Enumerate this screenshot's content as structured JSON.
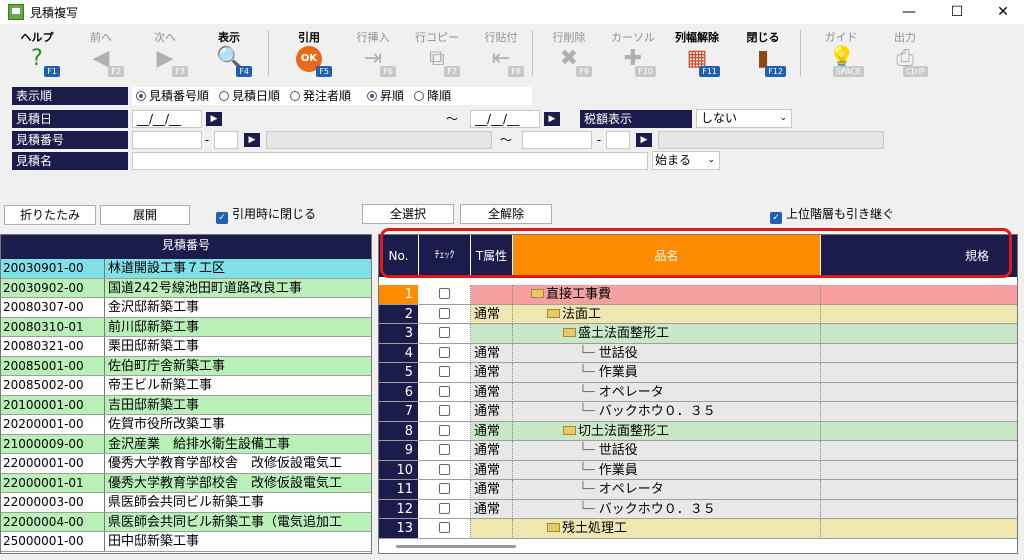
{
  "window": {
    "title": "見積複写"
  },
  "toolbar": [
    {
      "label": "ヘルプ",
      "key": "F1",
      "enabled": true,
      "icon": "help-icon",
      "glyph": "?",
      "color": "#2e8b2e"
    },
    {
      "label": "前へ",
      "key": "F2",
      "enabled": false,
      "icon": "arrow-left-icon",
      "glyph": "◀",
      "color": "#b0b0b0"
    },
    {
      "label": "次へ",
      "key": "F3",
      "enabled": false,
      "icon": "arrow-right-icon",
      "glyph": "▶",
      "color": "#b0b0b0"
    },
    {
      "label": "表示",
      "key": "F4",
      "enabled": true,
      "icon": "magnifier-icon",
      "glyph": "🔍",
      "color": "#3a6ea5"
    },
    {
      "label": "引用",
      "key": "F5",
      "enabled": true,
      "icon": "ok-icon",
      "glyph": "OK",
      "color": "#e86a1a"
    },
    {
      "label": "行挿入",
      "key": "F6",
      "enabled": false,
      "icon": "insert-row-icon",
      "glyph": "⇥",
      "color": "#b0b0b0"
    },
    {
      "label": "行コピー",
      "key": "F7",
      "enabled": false,
      "icon": "copy-row-icon",
      "glyph": "⧉",
      "color": "#b0b0b0"
    },
    {
      "label": "行貼付",
      "key": "F8",
      "enabled": false,
      "icon": "paste-row-icon",
      "glyph": "⇤",
      "color": "#b0b0b0"
    },
    {
      "label": "行削除",
      "key": "F9",
      "enabled": false,
      "icon": "delete-row-icon",
      "glyph": "✖",
      "color": "#b0b0b0"
    },
    {
      "label": "カーソル",
      "key": "F10",
      "enabled": false,
      "icon": "cursor-icon",
      "glyph": "✚",
      "color": "#b0b0b0"
    },
    {
      "label": "列幅解除",
      "key": "F11",
      "enabled": true,
      "icon": "column-width-icon",
      "glyph": "▦",
      "color": "#d04a2a"
    },
    {
      "label": "閉じる",
      "key": "F12",
      "enabled": true,
      "icon": "door-icon",
      "glyph": "▮",
      "color": "#8b4a1a"
    },
    {
      "label": "ガイド",
      "key": "SPACE",
      "enabled": false,
      "icon": "bulb-icon",
      "glyph": "💡",
      "color": "#b0b0b0"
    },
    {
      "label": "出力",
      "key": "CtrlP",
      "enabled": false,
      "icon": "output-icon",
      "glyph": "⎙",
      "color": "#b0b0b0"
    }
  ],
  "filters": {
    "order_label": "表示順",
    "order_options": [
      "見積番号順",
      "見積日順",
      "発注者順"
    ],
    "order_selected": 0,
    "direction_options": [
      "昇順",
      "降順"
    ],
    "direction_selected": 0,
    "date_label": "見積日",
    "date_from": "__/__/__",
    "date_to": "__/__/__",
    "tilde": "～",
    "tax_label": "税額表示",
    "tax_value": "しない",
    "number_label": "見積番号",
    "name_label": "見積名",
    "match_value": "始まる"
  },
  "actions": {
    "collapse": "折りたたみ",
    "expand": "展開",
    "close_on_quote": "引用時に閉じる",
    "select_all": "全選択",
    "deselect_all": "全解除",
    "inherit_parent": "上位階層も引き継ぐ"
  },
  "list": {
    "header": "見積番号",
    "rows": [
      {
        "no": "20030901-00",
        "name": "林道開設工事７工区",
        "bg": "#7fe0e8"
      },
      {
        "no": "20030902-00",
        "name": "国道242号線池田町道路改良工事",
        "bg": "#b8f0b8"
      },
      {
        "no": "20080307-00",
        "name": "金沢邸新築工事",
        "bg": "#ffffff"
      },
      {
        "no": "20080310-01",
        "name": "前川邸新築工事",
        "bg": "#b8f0b8"
      },
      {
        "no": "20080321-00",
        "name": "栗田邸新築工事",
        "bg": "#ffffff"
      },
      {
        "no": "20085001-00",
        "name": "佐伯町庁舎新築工事",
        "bg": "#b8f0b8"
      },
      {
        "no": "20085002-00",
        "name": "帝王ビル新築工事",
        "bg": "#ffffff"
      },
      {
        "no": "20100001-00",
        "name": "吉田邸新築工事",
        "bg": "#b8f0b8"
      },
      {
        "no": "20200001-00",
        "name": "佐賀市役所改築工事",
        "bg": "#ffffff"
      },
      {
        "no": "21000009-00",
        "name": "金沢産業　給排水衛生設備工事",
        "bg": "#b8f0b8"
      },
      {
        "no": "22000001-00",
        "name": "優秀大学教育学部校舎　改修仮設電気工",
        "bg": "#ffffff"
      },
      {
        "no": "22000001-01",
        "name": "優秀大学教育学部校舎　改修仮設電気工",
        "bg": "#b8f0b8"
      },
      {
        "no": "22000003-00",
        "name": "県医師会共同ビル新築工事",
        "bg": "#ffffff"
      },
      {
        "no": "22000004-00",
        "name": "県医師会共同ビル新築工事（電気追加工",
        "bg": "#b8f0b8"
      },
      {
        "no": "25000001-00",
        "name": "田中邸新築工事",
        "bg": "#ffffff"
      }
    ]
  },
  "grid": {
    "headers": {
      "no": "No.",
      "check": "ﾁｪｯｸ",
      "attr": "T属性",
      "name": "品名",
      "spec": "規格"
    },
    "rows": [
      {
        "no": "1",
        "attr": "",
        "name": "直接工事費",
        "level": 0,
        "folder": true,
        "bg": "#f4a0a0",
        "current": true
      },
      {
        "no": "2",
        "attr": "通常",
        "name": "法面工",
        "level": 1,
        "folder": true,
        "bg": "#f0e6b0"
      },
      {
        "no": "3",
        "attr": "",
        "name": "盛土法面整形工",
        "level": 2,
        "folder": true,
        "bg": "#c8e8c8"
      },
      {
        "no": "4",
        "attr": "通常",
        "name": "世話役",
        "level": 3,
        "folder": false,
        "bg": "#e8e8e8"
      },
      {
        "no": "5",
        "attr": "通常",
        "name": "作業員",
        "level": 3,
        "folder": false,
        "bg": "#e8e8e8"
      },
      {
        "no": "6",
        "attr": "通常",
        "name": "オペレータ",
        "level": 3,
        "folder": false,
        "bg": "#e8e8e8"
      },
      {
        "no": "7",
        "attr": "通常",
        "name": "バックホウ０．３５",
        "level": 3,
        "folder": false,
        "bg": "#e8e8e8"
      },
      {
        "no": "8",
        "attr": "通常",
        "name": "切土法面整形工",
        "level": 2,
        "folder": true,
        "bg": "#c8e8c8"
      },
      {
        "no": "9",
        "attr": "通常",
        "name": "世話役",
        "level": 3,
        "folder": false,
        "bg": "#e8e8e8"
      },
      {
        "no": "10",
        "attr": "通常",
        "name": "作業員",
        "level": 3,
        "folder": false,
        "bg": "#e8e8e8"
      },
      {
        "no": "11",
        "attr": "通常",
        "name": "オペレータ",
        "level": 3,
        "folder": false,
        "bg": "#e8e8e8"
      },
      {
        "no": "12",
        "attr": "通常",
        "name": "バックホウ０．３５",
        "level": 3,
        "folder": false,
        "bg": "#e8e8e8"
      },
      {
        "no": "13",
        "attr": "",
        "name": "残土処理工",
        "level": 1,
        "folder": true,
        "bg": "#f0e6b0"
      }
    ]
  },
  "colors": {
    "navy": "#1c1c4c",
    "orange": "#ff8c00",
    "highlight": "#e01818",
    "accent": "#1f5fb4"
  }
}
